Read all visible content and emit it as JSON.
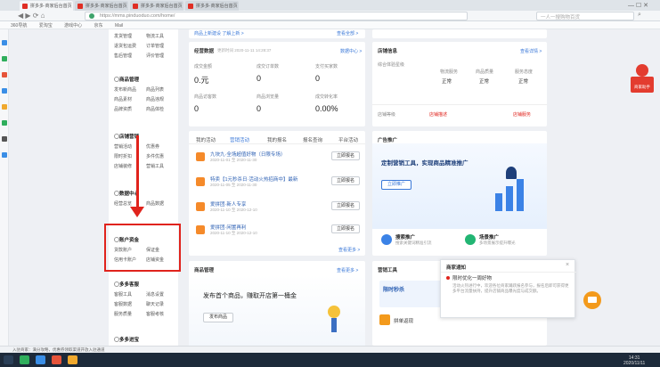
{
  "browser": {
    "tabs": [
      "拼多多·商家后台首页",
      "拼多多·商家后台首页",
      "拼多多·商家后台首页",
      "拼多多·商家后台首页"
    ],
    "url": "https://mms.pinduoduo.com/home/",
    "search_placeholder": "一人一搜购物百货",
    "bookmarks": [
      "360导航",
      "爱淘宝",
      "游戏中心",
      "京东",
      "Mail"
    ]
  },
  "leftnav": {
    "groups": [
      {
        "title": "",
        "items": [
          "发货管理",
          "物流工具",
          "退货包运费",
          "订单管理",
          "售后管理",
          "评价管理"
        ]
      },
      {
        "title": "商品管理",
        "items": [
          "发布新商品",
          "商品列表",
          "商品素材",
          "商品违规",
          "品牌资质",
          "商品体检"
        ]
      },
      {
        "title": "店铺营销",
        "items": [
          "营销活动",
          "优惠券",
          "限时折扣",
          "多件优惠",
          "店铺装修",
          "营销工具"
        ]
      },
      {
        "title": "数据中心",
        "items": [
          "经营总览",
          "商品数据"
        ]
      },
      {
        "title": "账户资金",
        "items": [
          "货款账户",
          "保证金",
          "信用卡账户",
          "店铺资金"
        ]
      },
      {
        "title": "多多客服",
        "items": [
          "客服工具",
          "消息设置",
          "客服数据",
          "聊天记录",
          "服务质量",
          "客服考核"
        ]
      },
      {
        "title": "多多进宝",
        "items": [
          "推广设置",
          "推广数据"
        ]
      }
    ]
  },
  "overview": {
    "title": "经营数据",
    "subtitle": "更新时间 2020-11-11 14:28:37",
    "link": "数据中心 >",
    "stats": [
      {
        "label": "成交金额",
        "value": "0.元"
      },
      {
        "label": "成交订单数",
        "value": "0"
      },
      {
        "label": "支付买家数",
        "value": "0"
      },
      {
        "label": "商品访客数",
        "value": "0"
      },
      {
        "label": "商品浏览量",
        "value": "0"
      },
      {
        "label": "成交转化率",
        "value": "0.00%"
      }
    ],
    "top_note": "商品上新建设 了解上新 >",
    "top_link": "查看全部 >"
  },
  "shopinfo": {
    "title": "店铺信息",
    "link": "查看详情 >",
    "cols": [
      "综合体验星级",
      "物流服务",
      "商品质量",
      "服务态度"
    ],
    "values": [
      "正常",
      "正常",
      "正常"
    ],
    "bottom": [
      "店铺等级",
      "店铺描述",
      "店铺服务"
    ]
  },
  "activities": {
    "tabs": [
      "我的活动",
      "营销活动",
      "我的报名",
      "报名查询",
      "平台活动"
    ],
    "rows": [
      {
        "title": "九块九·全场超值好物（日限专场）",
        "date": "2020-11-01 至 2020-11-30"
      },
      {
        "title": "特卖【1元秒杀日·活动火热招商中】最新",
        "date": "2020-11-05 至 2020-11-30"
      },
      {
        "title": "爱拼团·新人专享",
        "date": "2020-11-10 至 2020-12-10"
      },
      {
        "title": "爱拼团·闲置再利",
        "date": "2020-11-10 至 2020-12-10"
      }
    ],
    "button": "立即报名",
    "more": "查看更多 >"
  },
  "ads": {
    "title": "广告推广",
    "headline": "定制营销工具，实现商品精准推广",
    "button": "立即推广",
    "items": [
      {
        "name": "搜索推广",
        "desc": "搜索关键词精准引流"
      },
      {
        "name": "场景推广",
        "desc": "多场景展示提升曝光"
      }
    ]
  },
  "goods": {
    "title": "商品管理",
    "headline": "发布首个商品，赚取开店第一桶金",
    "button": "发布商品",
    "link": "查看更多 >"
  },
  "tools": {
    "title": "营销工具",
    "items": [
      "限时秒杀",
      "拼单返现",
      "多多进宝",
      "店铺优惠"
    ]
  },
  "popup": {
    "title": "商家通知",
    "item_title": "限时优化一周好物",
    "body": "活动火热进行中，欢迎各位商家踊跃报名参与，报名后即可获得更多平台流量扶持，提升店铺商品曝光度与成交额。"
  },
  "floatbtn": "商家助手",
  "statusbar": "入驻商家：满分攻略，优惠券领取渠道开放入驻通道",
  "clock": {
    "time": "14:31",
    "date": "2020/11/11"
  }
}
